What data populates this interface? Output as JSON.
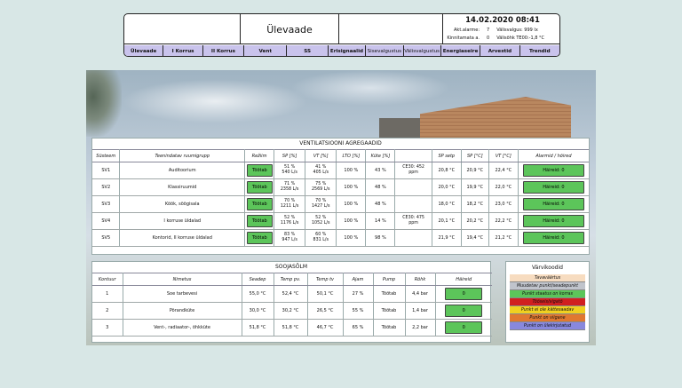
{
  "header": {
    "title": "Ülevaade",
    "datetime": "14.02.2020 08:41",
    "rows": [
      {
        "label": "Akt.alarme:",
        "value": "7",
        "text": "Välisvalgus: 999 lx"
      },
      {
        "label": "Kinnitamata a.",
        "value": "0",
        "text": "Välisõhk TE00:-1,8 °C"
      }
    ],
    "nav": [
      "Ülevaade",
      "I Korrus",
      "II Korrus",
      "Vent",
      "SS",
      "Erisignaalid",
      "Sisevalgustus",
      "Välisvalgustus",
      "Energiaseire",
      "Arvestid",
      "Trendid"
    ]
  },
  "vent": {
    "title": "VENTILATSIOONI AGREGAADID",
    "columns": [
      "Süsteem",
      "Teenindatav ruumigrupp",
      "Režiim",
      "SP [%]",
      "VT [%]",
      "LTO [%]",
      "Küte [%]",
      "",
      "SP setp",
      "SP [°C]",
      "VT [°C]",
      "Alarmid / hõired"
    ],
    "rows": [
      {
        "sys": "SV1",
        "group": "Auditoorium",
        "mode": "Töötab",
        "sp1": "51 %",
        "sp2": "540 L/s",
        "vt1": "41 %",
        "vt2": "405 L/s",
        "lto": "100 %",
        "kute": "43 %",
        "co1": "CE30: 452",
        "co2": "ppm",
        "setp": "20,8 °C",
        "spc": "20,9 °C",
        "vtc": "22,4 °C",
        "alarm": "Häireid: 0"
      },
      {
        "sys": "SV2",
        "group": "Klassiruumid",
        "mode": "Töötab",
        "sp1": "71 %",
        "sp2": "2358 L/s",
        "vt1": "75 %",
        "vt2": "2569 L/s",
        "lto": "100 %",
        "kute": "48 %",
        "co1": "",
        "co2": "",
        "setp": "20,0 °C",
        "spc": "19,9 °C",
        "vtc": "22,0 °C",
        "alarm": "Häireid: 0"
      },
      {
        "sys": "SV3",
        "group": "Köök, söögisala",
        "mode": "Töötab",
        "sp1": "70 %",
        "sp2": "1211 L/s",
        "vt1": "70 %",
        "vt2": "1427 L/s",
        "lto": "100 %",
        "kute": "48 %",
        "co1": "",
        "co2": "",
        "setp": "18,0 °C",
        "spc": "18,2 °C",
        "vtc": "23,0 °C",
        "alarm": "Häireid: 0"
      },
      {
        "sys": "SV4",
        "group": "I korruse üldalad",
        "mode": "Töötab",
        "sp1": "52 %",
        "sp2": "1176 L/s",
        "vt1": "52 %",
        "vt2": "1052 L/s",
        "lto": "100 %",
        "kute": "14 %",
        "co1": "CE30: 475",
        "co2": "ppm",
        "setp": "20,1 °C",
        "spc": "20,2 °C",
        "vtc": "22,2 °C",
        "alarm": "Häireid: 0"
      },
      {
        "sys": "SV5",
        "group": "Kontorid, II korruse üldalad",
        "mode": "Töötab",
        "sp1": "83 %",
        "sp2": "947 L/s",
        "vt1": "60 %",
        "vt2": "831 L/s",
        "lto": "100 %",
        "kute": "98 %",
        "co1": "",
        "co2": "",
        "setp": "21,9 °C",
        "spc": "19,4 °C",
        "vtc": "21,2 °C",
        "alarm": "Häireid: 0"
      }
    ]
  },
  "heat": {
    "title": "SOOJASÕLM",
    "columns": [
      "Kontuur",
      "Nimetus",
      "Seadep",
      "Temp pv.",
      "Temp tv",
      "Ajam",
      "Pump",
      "Rõhk",
      "Häireid"
    ],
    "rows": [
      {
        "k": "1",
        "name": "Soe tarbevesi",
        "sead": "55,0 °C",
        "tpv": "52,4 °C",
        "ttv": "50,1 °C",
        "ajam": "27 %",
        "pump": "Töötab",
        "rohk": "4,4 bar",
        "alarm": "0"
      },
      {
        "k": "2",
        "name": "Põrandküte",
        "sead": "30,0 °C",
        "tpv": "30,2 °C",
        "ttv": "26,5 °C",
        "ajam": "55 %",
        "pump": "Töötab",
        "rohk": "1,4 bar",
        "alarm": "0"
      },
      {
        "k": "3",
        "name": "Vent-, radiaator-, õhkküte",
        "sead": "51,8 °C",
        "tpv": "51,8 °C",
        "ttv": "46,7 °C",
        "ajam": "65 %",
        "pump": "Töötab",
        "rohk": "2,2 bar",
        "alarm": "0"
      }
    ]
  },
  "legend": {
    "title": "Värvikoodid",
    "items": [
      {
        "label": "Tavaväärtus",
        "color": "#f7dcc0"
      },
      {
        "label": "Muudetav punkt/seadepunkt",
        "color": "#c0c4cc"
      },
      {
        "label": "Punkt staatus on korras",
        "color": "#5cc55a"
      },
      {
        "label": "Tööseis/vigatõ",
        "color": "#d02020"
      },
      {
        "label": "Punkt ei ole kättesaadav",
        "color": "#f0d020"
      },
      {
        "label": "Punkt on viigane",
        "color": "#e07830"
      },
      {
        "label": "Punkt on ülekirjutatud",
        "color": "#8888dd"
      }
    ]
  }
}
